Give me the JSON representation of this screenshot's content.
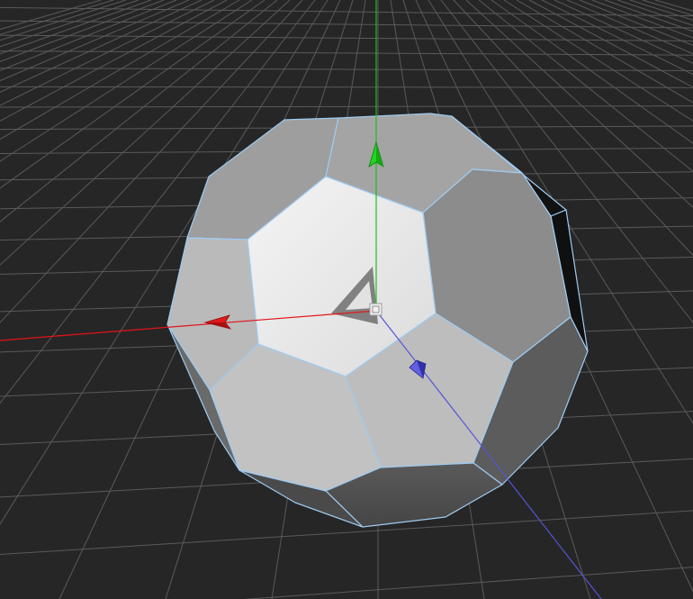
{
  "viewport": {
    "background": "#262626",
    "grid_color": "#5a5a5a",
    "grid_major_color": "#6a6a6a"
  },
  "object": {
    "shape": "truncated-octahedron",
    "selected": true,
    "edge_highlight_color": "#9ecbf2"
  },
  "axes": {
    "x_color": "#e0151b",
    "y_color": "#19c319",
    "z_color": "#5555d6"
  },
  "icons": {
    "pivot": "pivot-square-icon",
    "x_handle": "x-arrow-icon",
    "y_handle": "y-arrow-icon",
    "z_handle": "z-arrow-icon"
  }
}
